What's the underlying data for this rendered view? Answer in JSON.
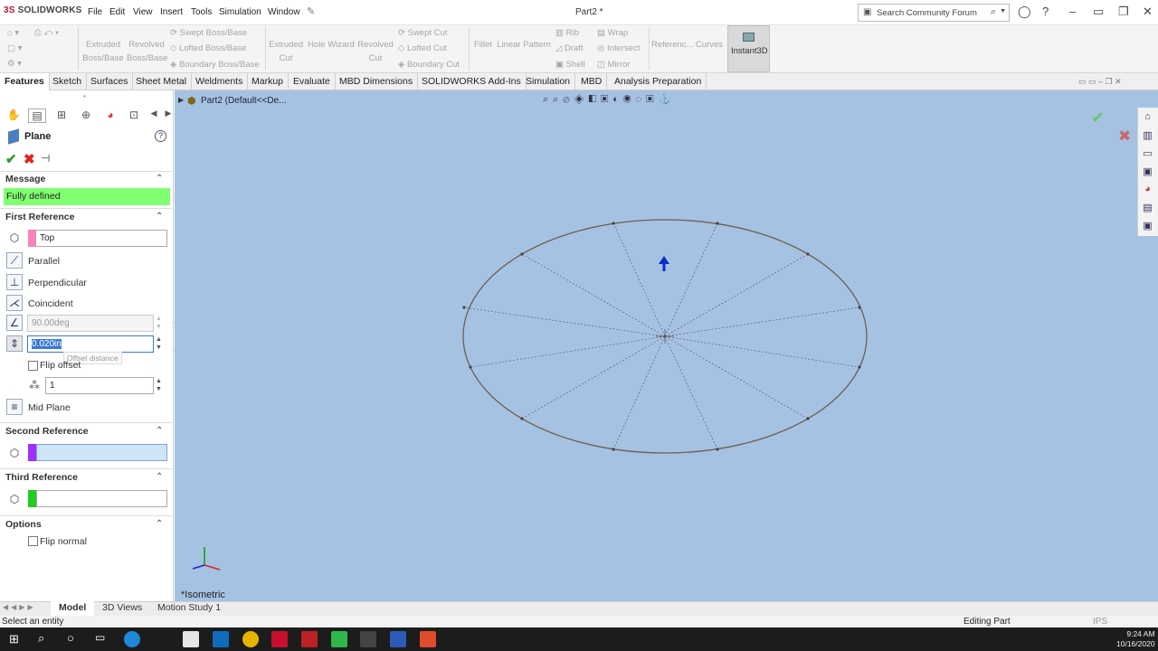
{
  "app": {
    "brand": "SOLIDWORKS",
    "document_title": "Part2 *",
    "menu": [
      "File",
      "Edit",
      "View",
      "Insert",
      "Tools",
      "Simulation",
      "Window"
    ]
  },
  "search": {
    "placeholder": "Search Community Forum"
  },
  "commands": {
    "extruded_boss": "Extruded Boss/Base",
    "revolved_boss": "Revolved Boss/Base",
    "swept_boss": "Swept Boss/Base",
    "lofted_boss": "Lofted Boss/Base",
    "boundary_boss": "Boundary Boss/Base",
    "extruded_cut": "Extruded Cut",
    "hole_wizard": "Hole Wizard",
    "revolved_cut": "Revolved Cut",
    "swept_cut": "Swept Cut",
    "lofted_cut": "Lofted Cut",
    "boundary_cut": "Boundary Cut",
    "fillet": "Fillet",
    "linear_pattern": "Linear Pattern",
    "rib": "Rib",
    "draft": "Draft",
    "shell": "Shell",
    "wrap": "Wrap",
    "intersect": "Intersect",
    "mirror": "Mirror",
    "reference": "Referenc...",
    "curves": "Curves",
    "instant3d": "Instant3D"
  },
  "tabs": [
    "Features",
    "Sketch",
    "Surfaces",
    "Sheet Metal",
    "Weldments",
    "Markup",
    "Evaluate",
    "MBD Dimensions",
    "SOLIDWORKS Add-Ins",
    "Simulation",
    "MBD",
    "Analysis Preparation"
  ],
  "property_manager": {
    "title": "Plane",
    "message_header": "Message",
    "message": "Fully defined",
    "first_reference_header": "First Reference",
    "first_reference_value": "Top",
    "parallel": "Parallel",
    "perpendicular": "Perpendicular",
    "coincident": "Coincident",
    "angle_value": "90.00deg",
    "offset_value": "0.020in",
    "offset_tooltip": "Offset distance",
    "flip_offset": "Flip offset",
    "count_value": "1",
    "mid_plane": "Mid Plane",
    "second_reference_header": "Second Reference",
    "third_reference_header": "Third Reference",
    "options_header": "Options",
    "flip_normal": "Flip normal"
  },
  "tree": {
    "root": "Part2  (Default<<De..."
  },
  "viewport": {
    "view_label": "*Isometric"
  },
  "bottom_tabs": [
    "Model",
    "3D Views",
    "Motion Study 1"
  ],
  "status": {
    "left": "Select an entity",
    "mode": "Editing Part",
    "units": "IPS"
  },
  "clock": {
    "time": "9:24 AM",
    "date": "10/16/2020"
  },
  "colors": {
    "viewport_bg": "#a6c2e3",
    "message_bg": "#80ff70",
    "first_ref_swatch": "#ff80c0",
    "second_ref_swatch": "#9b30ff",
    "third_ref_swatch": "#22cc22",
    "accent_red": "#c8102e"
  }
}
